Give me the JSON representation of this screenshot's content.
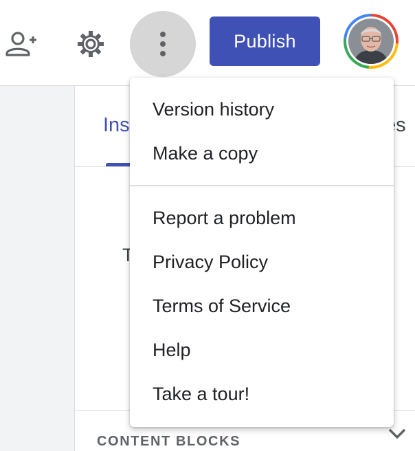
{
  "toolbar": {
    "add_user_icon": "person-add-icon",
    "settings_icon": "gear-icon",
    "more_icon": "more-vert-icon",
    "publish_label": "Publish",
    "avatar_icon": "account-avatar"
  },
  "panel": {
    "tabs": [
      {
        "label": "Ins"
      },
      {
        "label": "es"
      }
    ],
    "behind_text": "T",
    "content_blocks_label": "CONTENT BLOCKS",
    "chevron_icon": "chevron-down-icon"
  },
  "menu": {
    "group1": [
      {
        "label": "Version history"
      },
      {
        "label": "Make a copy"
      }
    ],
    "group2": [
      {
        "label": "Report a problem"
      },
      {
        "label": "Privacy Policy"
      },
      {
        "label": "Terms of Service"
      },
      {
        "label": "Help"
      },
      {
        "label": "Take a tour!"
      }
    ]
  },
  "colors": {
    "accent": "#3f51b5",
    "more_button_bg": "#d6d6d6",
    "divider": "#dadce0",
    "side_gray": "#f1f3f4"
  }
}
